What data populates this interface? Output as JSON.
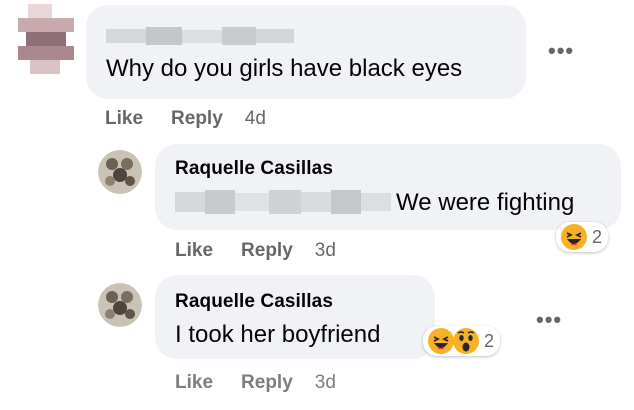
{
  "comments": [
    {
      "author_redacted": true,
      "text": "Why do you girls have black eyes",
      "actions": {
        "like": "Like",
        "reply": "Reply",
        "time": "4d"
      },
      "more": "•••"
    },
    {
      "author": "Raquelle Casillas",
      "text": "We were fighting",
      "mention_redacted": true,
      "reactions": {
        "icons": [
          "haha-icon"
        ],
        "count": "2"
      },
      "actions": {
        "like": "Like",
        "reply": "Reply",
        "time": "3d"
      }
    },
    {
      "author": "Raquelle Casillas",
      "text": "I took her boyfriend",
      "reactions": {
        "icons": [
          "haha-icon",
          "wow-icon"
        ],
        "count": "2"
      },
      "actions": {
        "like": "Like",
        "reply": "Reply",
        "time": "3d"
      },
      "more": "•••"
    }
  ],
  "colors": {
    "bubble": "#f0f2f5",
    "meta": "#65676b",
    "text": "#050505",
    "emoji": "#f7b125"
  }
}
